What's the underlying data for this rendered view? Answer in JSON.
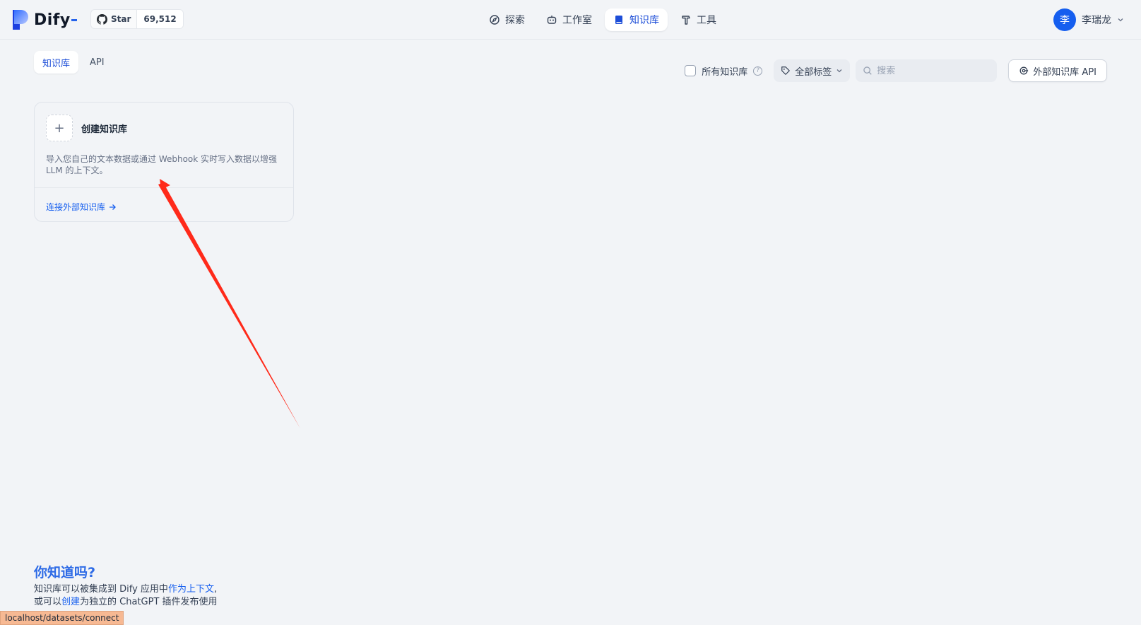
{
  "header": {
    "logo_text": "Dify",
    "github": {
      "star_label": "Star",
      "count": "69,512"
    },
    "nav": [
      {
        "label": "探索",
        "icon": "compass-icon"
      },
      {
        "label": "工作室",
        "icon": "robot-icon"
      },
      {
        "label": "知识库",
        "icon": "book-icon",
        "active": true
      },
      {
        "label": "工具",
        "icon": "hammer-icon"
      }
    ],
    "user": {
      "avatar_letter": "李",
      "name": "李瑞龙"
    }
  },
  "tabs": [
    {
      "label": "知识库",
      "active": true
    },
    {
      "label": "API",
      "active": false
    }
  ],
  "filters": {
    "all_datasets_label": "所有知识库",
    "tag_select_label": "全部标签",
    "search_placeholder": "搜索",
    "external_api_button": "外部知识库 API"
  },
  "create_card": {
    "title": "创建知识库",
    "description": "导入您自己的文本数据或通过 Webhook 实时写入数据以增强 LLM 的上下文。",
    "connect_link": "连接外部知识库"
  },
  "did_you_know": {
    "title": "你知道吗?",
    "line1_a": "知识库可以被集成到 Dify 应用中",
    "line1_link": "作为上下文",
    "line1_b": ",",
    "line2_a": "或可以",
    "line2_link": "创建",
    "line2_b": "为独立的 ChatGPT 插件发布使用"
  },
  "status_url": "localhost/datasets/connect",
  "colors": {
    "accent": "#155eef",
    "annotation_arrow": "#ff2a1a"
  }
}
